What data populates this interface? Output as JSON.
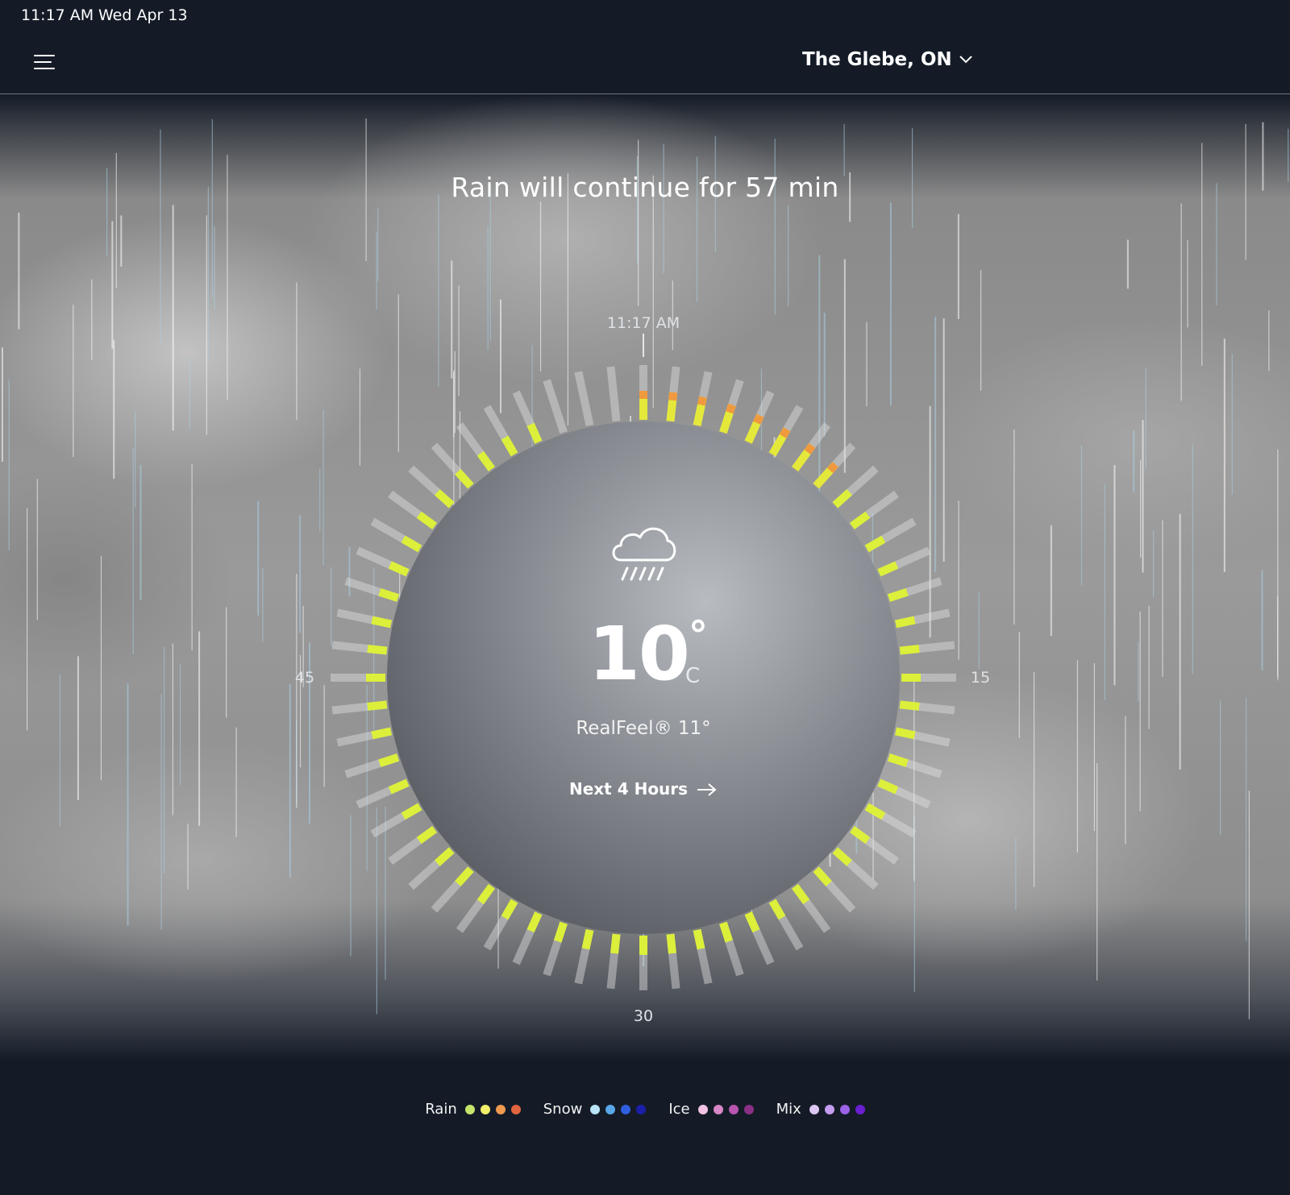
{
  "status_bar": {
    "time": "11:17 AM",
    "date": "Wed Apr 13"
  },
  "header": {
    "location": "The Glebe, ON",
    "menu_icon": "hamburger-menu-icon",
    "dropdown_icon": "chevron-down-icon"
  },
  "headline": "Rain will continue for 57 min",
  "dial": {
    "current_time_label": "11:17 AM",
    "labels": {
      "right": "15",
      "bottom": "30",
      "left": "45"
    },
    "minute_segments": 60,
    "precip_minutes": 57
  },
  "current": {
    "icon": "cloud-rain-icon",
    "temperature": "10",
    "degree": "°",
    "unit": "C",
    "realfeel": "RealFeel® 11°",
    "next_link": "Next 4 Hours"
  },
  "legend": [
    {
      "label": "Rain",
      "colors": [
        "#c6e66b",
        "#f2ef6a",
        "#ef9a4f",
        "#e2653f"
      ]
    },
    {
      "label": "Snow",
      "colors": [
        "#b9e4f5",
        "#5aa7e8",
        "#2f5fe0",
        "#1b1fa8"
      ]
    },
    {
      "label": "Ice",
      "colors": [
        "#f3c2e4",
        "#d887c9",
        "#b955b0",
        "#8b2f86"
      ]
    },
    {
      "label": "Mix",
      "colors": [
        "#dcc6f3",
        "#c49cf0",
        "#9c63e8",
        "#6a1fd0"
      ]
    }
  ]
}
